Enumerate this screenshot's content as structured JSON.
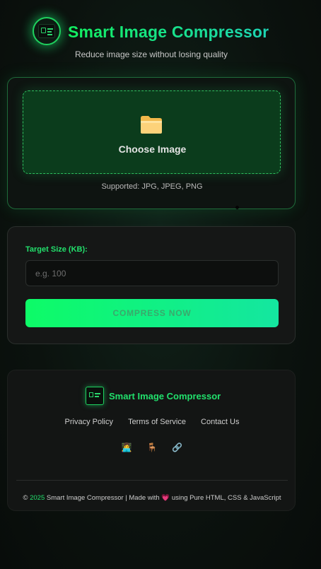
{
  "header": {
    "title": "Smart Image Compressor",
    "subtitle": "Reduce image size without losing quality",
    "logo_icon": "compress-logo-icon"
  },
  "upload": {
    "icon": "folder-icon",
    "choose_label": "Choose Image",
    "supported": "Supported: JPG, JPEG, PNG"
  },
  "compress": {
    "target_label": "Target Size (KB):",
    "input_value": "",
    "input_placeholder": "e.g. 100",
    "button_label": "COMPRESS NOW"
  },
  "footer": {
    "brand": "Smart Image Compressor",
    "links": [
      "Privacy Policy",
      "Terms of Service",
      "Contact Us"
    ],
    "social": [
      {
        "icon": "developer-icon",
        "glyph": "👩‍💻"
      },
      {
        "icon": "chair-icon",
        "glyph": "🪑"
      },
      {
        "icon": "link-icon",
        "glyph": "🔗"
      }
    ],
    "copyright_prefix": "©",
    "copyright_year": "2025",
    "copyright_mid": "Smart Image Compressor | Made with",
    "heart_glyph": "💗",
    "copyright_suffix": "using Pure HTML, CSS & JavaScript"
  },
  "colors": {
    "accent": "#19e37a",
    "button_gradient_start": "#0dfb67",
    "button_gradient_end": "#14e6a0",
    "dropzone_bg": "#0b3c1c"
  }
}
